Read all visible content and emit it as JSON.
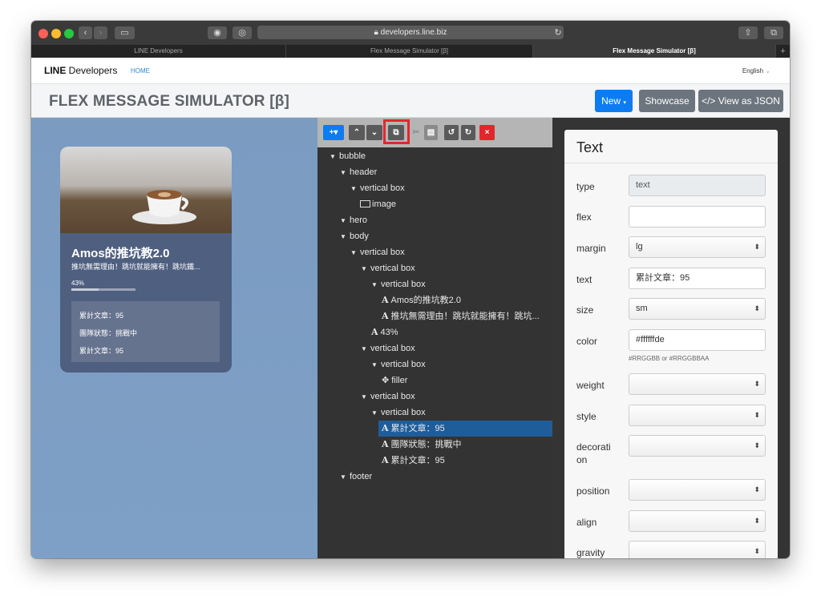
{
  "browser": {
    "url": "developers.line.biz",
    "tabs": [
      "LINE Developers",
      "Flex Message Simulator [β]",
      "Flex Message Simulator [β]"
    ],
    "new_tab": "+"
  },
  "header": {
    "logo_bold": "LINE",
    "logo_rest": " Developers",
    "home": "HOME",
    "language": "English"
  },
  "simulator": {
    "title": "FLEX MESSAGE SIMULATOR [β]",
    "new_label": "New",
    "showcase_label": "Showcase",
    "view_json_label": "</> View as JSON"
  },
  "preview": {
    "title": "Amos的推坑教2.0",
    "subtitle": "推坑無需理由！跳坑就能擁有！跳坑鐵...",
    "progress_text": "43%",
    "progress": 0.43,
    "stats": [
      "累計文章：95",
      "團隊狀態：挑戰中",
      "累計文章：95"
    ]
  },
  "tree": [
    {
      "label": "bubble",
      "kind": "open"
    },
    {
      "label": "header",
      "kind": "open"
    },
    {
      "label": "vertical box",
      "kind": "open"
    },
    {
      "label": "image",
      "kind": "image"
    },
    {
      "label": "hero",
      "kind": "open"
    },
    {
      "label": "body",
      "kind": "open"
    },
    {
      "label": "vertical box",
      "kind": "open"
    },
    {
      "label": "vertical box",
      "kind": "open"
    },
    {
      "label": "vertical box",
      "kind": "open"
    },
    {
      "label": "Amos的推坑教2.0",
      "kind": "text"
    },
    {
      "label": "推坑無需理由！跳坑就能擁有！跳坑...",
      "kind": "text"
    },
    {
      "label": "43%",
      "kind": "text"
    },
    {
      "label": "vertical box",
      "kind": "open"
    },
    {
      "label": "vertical box",
      "kind": "open"
    },
    {
      "label": "filler",
      "kind": "filler"
    },
    {
      "label": "vertical box",
      "kind": "open"
    },
    {
      "label": "vertical box",
      "kind": "open"
    },
    {
      "label": "累計文章：95",
      "kind": "text",
      "selected": true
    },
    {
      "label": "團隊狀態：挑戰中",
      "kind": "text"
    },
    {
      "label": "累計文章：95",
      "kind": "text"
    },
    {
      "label": "footer",
      "kind": "open"
    }
  ],
  "props": {
    "heading": "Text",
    "type_label": "type",
    "type_value": "text",
    "flex_label": "flex",
    "flex_value": "",
    "margin_label": "margin",
    "margin_value": "lg",
    "text_label": "text",
    "text_value": "累計文章：95",
    "size_label": "size",
    "size_value": "sm",
    "color_label": "color",
    "color_value": "#ffffffde",
    "color_hint": "#RRGGBB or #RRGGBBAA",
    "weight_label": "weight",
    "style_label": "style",
    "decoration_label": "decorati\non",
    "position_label": "position",
    "align_label": "align",
    "gravity_label": "gravity"
  },
  "colors": {
    "accent": "#0d7cf2",
    "highlight": "#e3262d",
    "selected": "#1e5d9a"
  }
}
